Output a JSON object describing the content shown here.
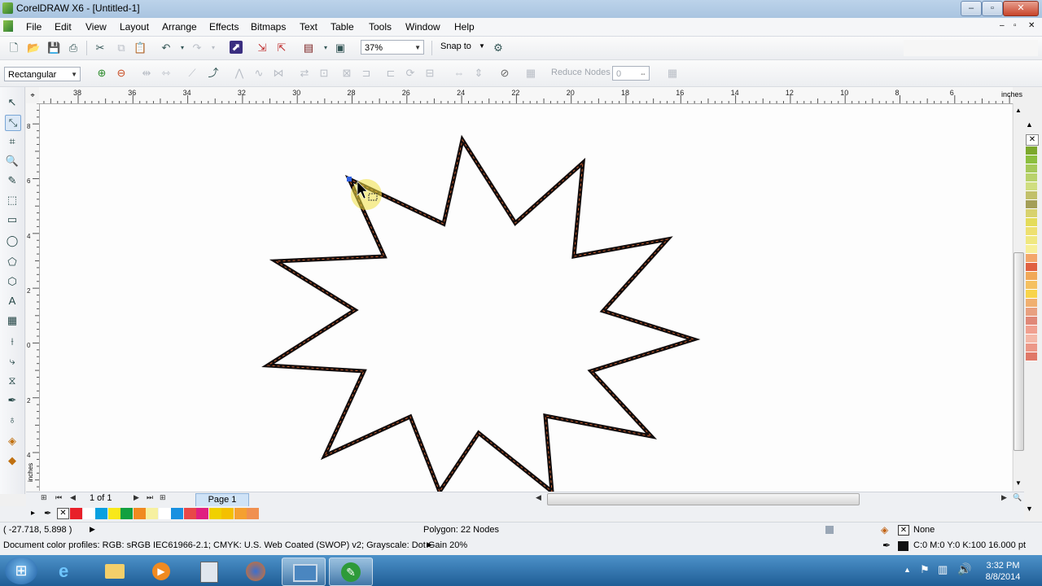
{
  "window": {
    "title": "CorelDRAW X6 - [Untitled-1]"
  },
  "menu": [
    "File",
    "Edit",
    "View",
    "Layout",
    "Arrange",
    "Effects",
    "Bitmaps",
    "Text",
    "Table",
    "Tools",
    "Window",
    "Help"
  ],
  "toolbar": {
    "zoom": "37%",
    "snap_label": "Snap to"
  },
  "propbar": {
    "curve_mode": "Rectangular",
    "reduce_nodes_label": "Reduce Nodes",
    "reduce_nodes_value": "0"
  },
  "ruler": {
    "unit": "inches",
    "h_ticks": [
      "38",
      "36",
      "34",
      "32",
      "30",
      "28",
      "26",
      "24",
      "22",
      "20",
      "18",
      "16",
      "14",
      "12",
      "10",
      "8",
      "6"
    ],
    "v_ticks": [
      "8",
      "6",
      "4",
      "2",
      "0",
      "2",
      "4"
    ],
    "v_unit": "inches"
  },
  "pages": {
    "counter": "1 of 1",
    "tab": "Page 1"
  },
  "status": {
    "coords": "( -27.718, 5.898 )",
    "selection": "Polygon: 22 Nodes",
    "fill_label": "None",
    "profile": "Document color profiles: RGB: sRGB IEC61966-2.1; CMYK: U.S. Web Coated (SWOP) v2; Grayscale: Dot Gain 20%",
    "outline": "C:0 M:0 Y:0 K:100  16.000 pt"
  },
  "taskbar": {
    "time": "3:32 PM",
    "date": "8/8/2014"
  },
  "colors": {
    "outline": "#000000",
    "palette": [
      "#7ca82c",
      "#8cbf3f",
      "#a6c95a",
      "#b9d26b",
      "#d0de80",
      "#c2c06a",
      "#a49e58",
      "#d8d26e",
      "#e4dc5a",
      "#eee070",
      "#f0e880",
      "#f7ef98",
      "#f3a66a",
      "#e06040",
      "#f0a858",
      "#f5c060",
      "#f8d44a",
      "#f0b070",
      "#e8a080",
      "#e08878",
      "#f0a090",
      "#f4b8a8",
      "#ec9888",
      "#e07868"
    ],
    "colorbar": [
      "#e8202a",
      "#ffffff",
      "#0aa0e0",
      "#f8e81a",
      "#12a040",
      "#f08a20",
      "#f6f0a0",
      "#ffffff",
      "#1890e0",
      "#e84848",
      "#e02080",
      "#f0d000",
      "#f4c000",
      "#f5a030",
      "#f09050"
    ]
  }
}
